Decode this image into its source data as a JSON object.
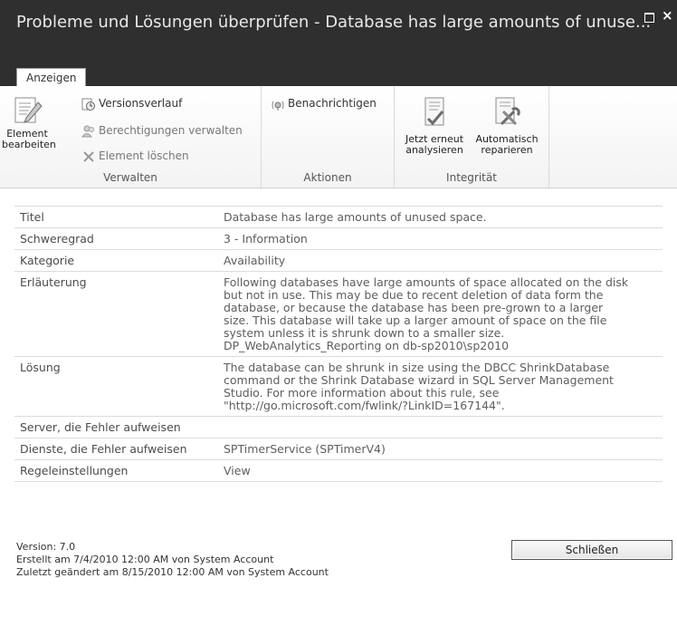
{
  "window": {
    "title": "Probleme und Lösungen überprüfen - Database has large amounts of unuse...",
    "maximize_icon": "maximize-icon",
    "close_symbol": "×"
  },
  "tabs": [
    {
      "label": "Anzeigen",
      "selected": true
    }
  ],
  "ribbon": {
    "verwalten": {
      "label": "Verwalten",
      "edit_item": {
        "line1": "Element",
        "line2": "bearbeiten"
      },
      "version_history": "Versionsverlauf",
      "manage_permissions": "Berechtigungen verwalten",
      "delete_item": "Element löschen"
    },
    "aktionen": {
      "label": "Aktionen",
      "notify": "Benachrichtigen"
    },
    "integritaet": {
      "label": "Integrität",
      "reanalyze": {
        "line1": "Jetzt erneut",
        "line2": "analysieren"
      },
      "autorepair": {
        "line1": "Automatisch",
        "line2": "reparieren"
      }
    }
  },
  "properties": [
    {
      "label": "Titel",
      "value": "Database has large amounts of unused space."
    },
    {
      "label": "Schweregrad",
      "value": "3 - Information"
    },
    {
      "label": "Kategorie",
      "value": "Availability"
    },
    {
      "label": "Erläuterung",
      "value": "Following databases have large amounts of space allocated on the disk\nbut not in use. This may be due to recent deletion of data form the\ndatabase, or because the database has been pre-grown to a larger\nsize. This database will take up a larger amount of space on the file\nsystem unless it is shrunk down to a smaller size.\nDP_WebAnalytics_Reporting on db-sp2010\\sp2010"
    },
    {
      "label": "Lösung",
      "value": "The database can be shrunk in size using the DBCC ShrinkDatabase\ncommand or the Shrink Database wizard in SQL Server Management\nStudio. For more information about this rule, see\n\"http://go.microsoft.com/fwlink/?LinkID=167144\"."
    },
    {
      "label": "Server, die Fehler aufweisen",
      "value": ""
    },
    {
      "label": "Dienste, die Fehler aufweisen",
      "value": "SPTimerService (SPTimerV4)"
    },
    {
      "label": "Regeleinstellungen",
      "value": "View"
    }
  ],
  "footer": {
    "version": "Version: 7.0",
    "created": "Erstellt am 7/4/2010 12:00 AM von System Account",
    "modified": "Zuletzt geändert am 8/15/2010 12:00 AM von System Account"
  },
  "close_button": "Schließen"
}
